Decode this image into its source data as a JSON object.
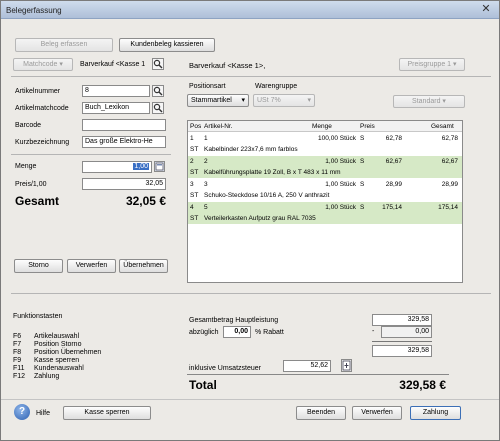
{
  "window": {
    "title": "Belegerfassung"
  },
  "top_buttons": {
    "beleg_erfassen": "Beleg erfassen",
    "kundenbeleg": "Kundenbeleg kassieren"
  },
  "matchcode": {
    "label": "Matchcode",
    "value": "Barverkauf <Kasse 1"
  },
  "header_kasse": "Barverkauf <Kasse 1>,",
  "preisgruppe": "Preisgruppe 1",
  "article": {
    "nummer_label": "Artikelnummer",
    "nummer_value": "8",
    "matchcode_label": "Artikelmatchcode",
    "matchcode_value": "Buch_Lexikon",
    "barcode_label": "Barcode",
    "barcode_value": "",
    "kurz_label": "Kurzbezeichnung",
    "kurz_value": "Das große Elektro-He"
  },
  "menge": {
    "label": "Menge",
    "value": "1,00"
  },
  "preis": {
    "label": "Preis/1,00",
    "value": "32,05"
  },
  "gesamt": {
    "label": "Gesamt",
    "value": "32,05 €"
  },
  "left_buttons": {
    "storno": "Storno",
    "verwerfen": "Verwerfen",
    "uebernehmen": "Übernehmen"
  },
  "positionsart": {
    "label": "Positionsart",
    "value": "Stammartikel"
  },
  "warengruppe": {
    "label": "Warengruppe",
    "value": "USt 7%"
  },
  "standard": "Standard",
  "table": {
    "headers": [
      "Pos",
      "Artikel-Nr.",
      "Menge",
      "Preis",
      "Gesamt"
    ],
    "rows": [
      {
        "pos": "1",
        "nr": "1",
        "menge": "100,00 Stück",
        "s": "S",
        "preis": "62,78",
        "gesamt": "62,78",
        "st": "ST",
        "desc": "Kabelbinder 223x7,6 mm farblos"
      },
      {
        "pos": "2",
        "nr": "2",
        "menge": "1,00 Stück",
        "s": "S",
        "preis": "62,67",
        "gesamt": "62,67",
        "st": "ST",
        "desc": "Kabelführungsplatte 19 Zoll, B x T 483 x 11 mm"
      },
      {
        "pos": "3",
        "nr": "3",
        "menge": "1,00 Stück",
        "s": "S",
        "preis": "28,99",
        "gesamt": "28,99",
        "st": "ST",
        "desc": "Schuko-Steckdose 10/16 A, 250 V anthrazit"
      },
      {
        "pos": "4",
        "nr": "5",
        "menge": "1,00 Stück",
        "s": "S",
        "preis": "175,14",
        "gesamt": "175,14",
        "st": "ST",
        "desc": "Verteilerkasten Aufputz grau RAL 7035"
      }
    ]
  },
  "funktionstasten": {
    "title": "Funktionstasten",
    "items": [
      {
        "key": "F6",
        "label": "Artikelauswahl"
      },
      {
        "key": "F7",
        "label": "Position Storno"
      },
      {
        "key": "F8",
        "label": "Position Übernehmen"
      },
      {
        "key": "F9",
        "label": "Kasse sperren"
      },
      {
        "key": "F11",
        "label": "Kundenauswahl"
      },
      {
        "key": "F12",
        "label": "Zahlung"
      }
    ]
  },
  "summary": {
    "hauptleistung_label": "Gesamtbetrag Hauptleistung",
    "hauptleistung_value": "329,58",
    "abzueglich_label": "abzüglich",
    "rabatt_pct": "0,00",
    "rabatt_label": "% Rabatt",
    "minus": "-",
    "rabatt_value": "0,00",
    "subtotal": "329,58",
    "ust_label": "inklusive Umsatzsteuer",
    "ust_value": "52,62",
    "total_label": "Total",
    "total_value": "329,58 €"
  },
  "bottom": {
    "hilfe": "Hilfe",
    "kasse_sperren": "Kasse sperren",
    "beenden": "Beenden",
    "verwerfen": "Verwerfen",
    "zahlung": "Zahlung"
  }
}
